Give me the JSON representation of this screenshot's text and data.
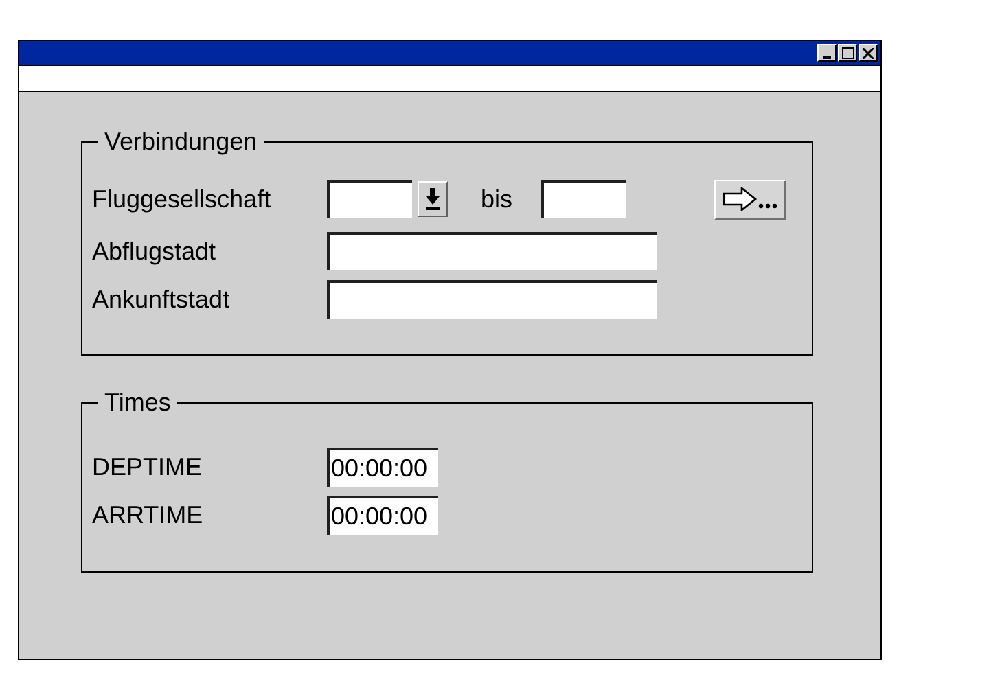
{
  "groups": [
    {
      "title": "Verbindungen",
      "rows": [
        {
          "kind": "range",
          "label": "Fluggesellschaft",
          "value": "",
          "separator": "bis",
          "value_to": ""
        },
        {
          "kind": "text",
          "label": "Abflugstadt",
          "value": ""
        },
        {
          "kind": "text",
          "label": "Ankunftstadt",
          "value": ""
        }
      ]
    },
    {
      "title": "Times",
      "rows": [
        {
          "kind": "time",
          "label": "DEPTIME",
          "value": "00:00:00"
        },
        {
          "kind": "time",
          "label": "ARRTIME",
          "value": "00:00:00"
        }
      ]
    }
  ]
}
